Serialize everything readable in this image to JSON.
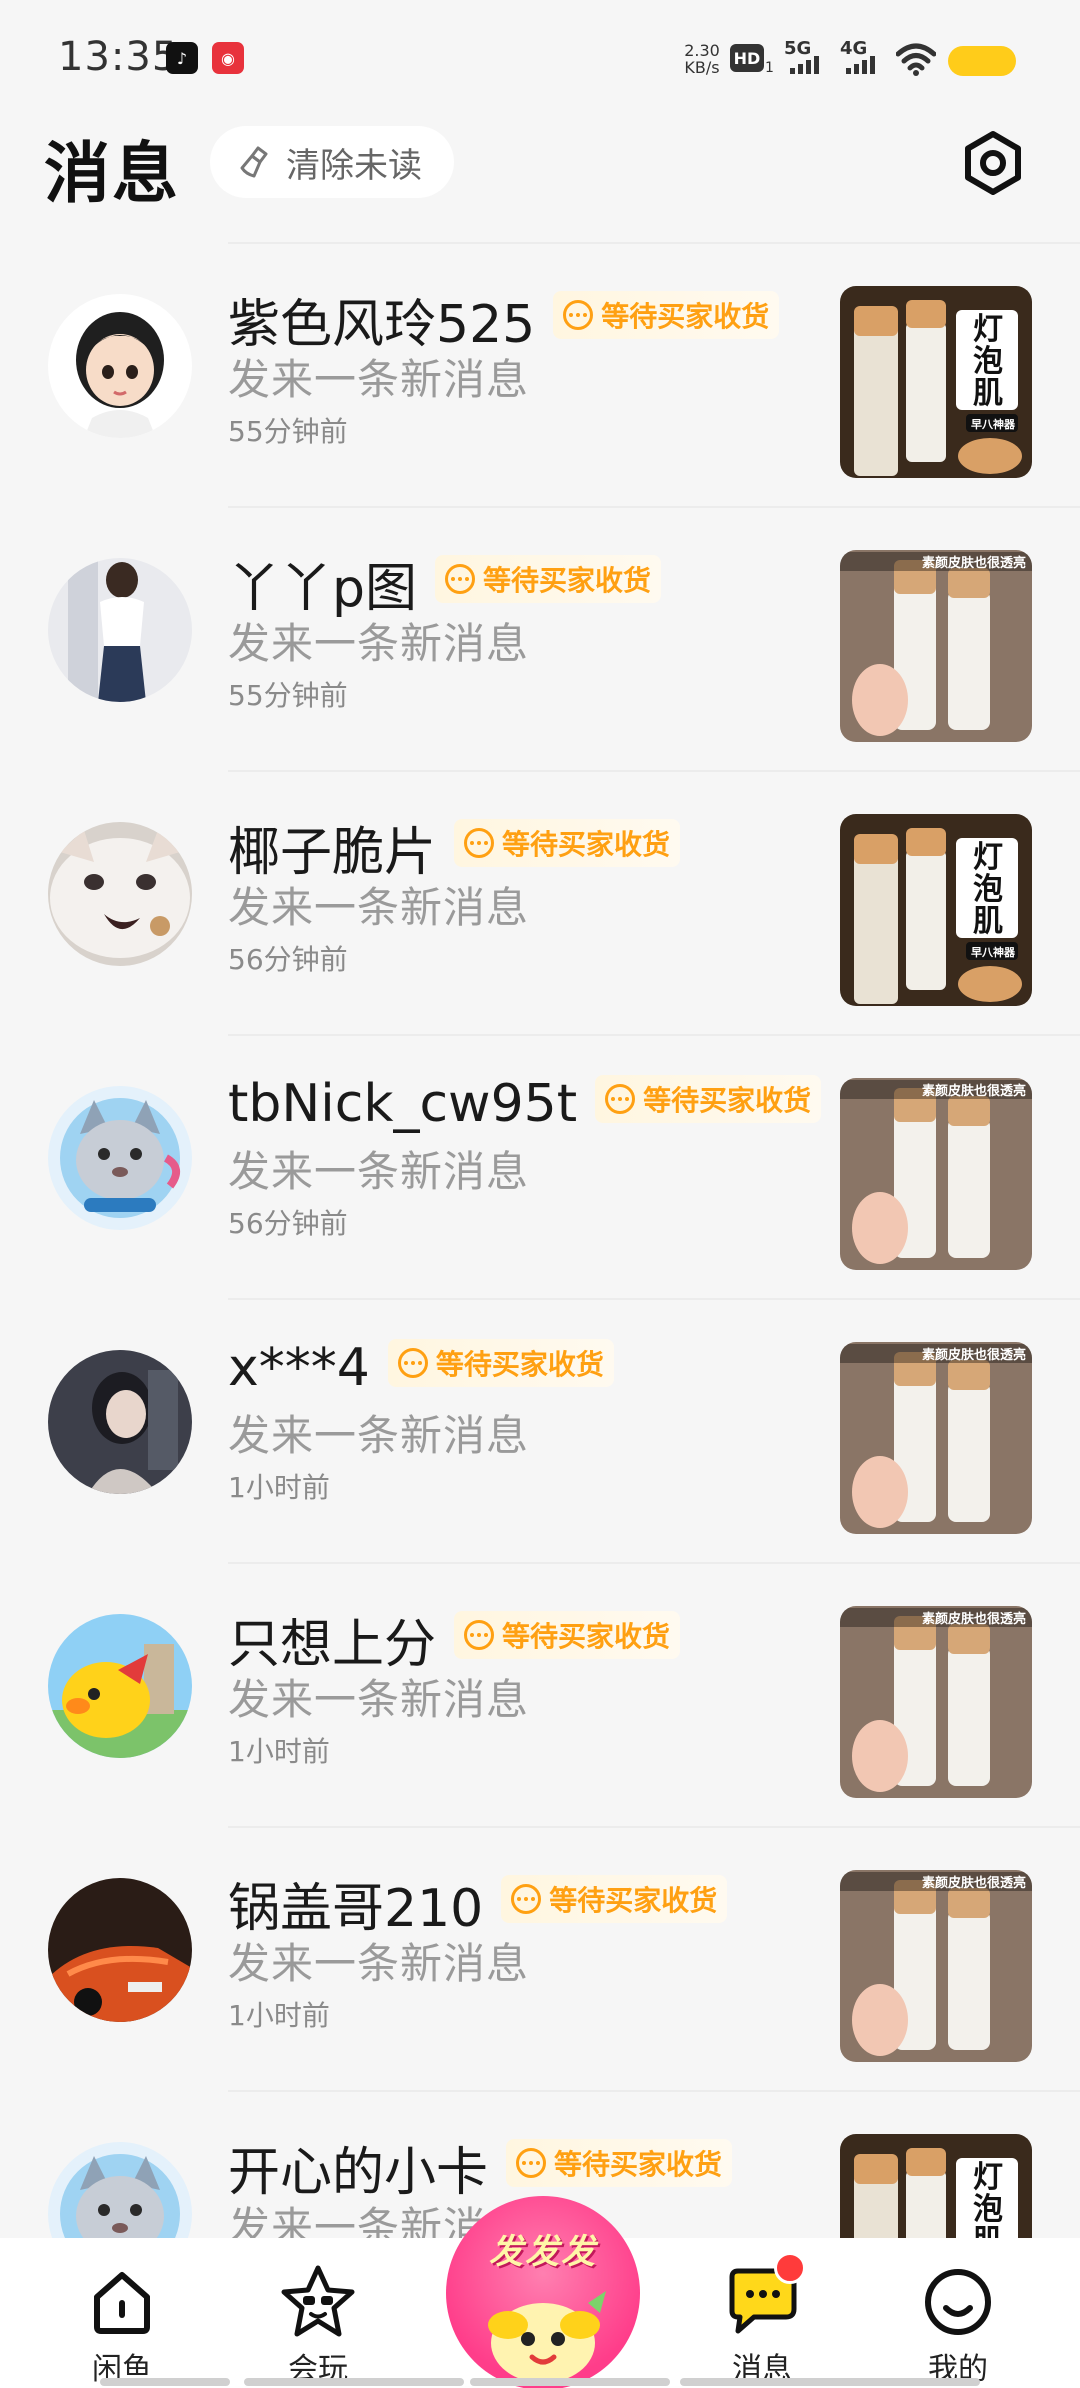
{
  "status_bar": {
    "time": "13:35",
    "net_speed_value": "2.30",
    "net_speed_unit": "KB/s",
    "hd_label": "HD",
    "hd_sub": "1",
    "sig1_label": "5G",
    "sig2_label": "4G",
    "notif_icons": [
      "tiktok-icon",
      "shopping-app-icon"
    ],
    "battery_color": "#ffcc1a"
  },
  "header": {
    "title": "消息",
    "clear_unread_label": "清除未读",
    "settings_icon": "hexagon-gear-icon"
  },
  "messages": [
    {
      "name": "紫色风玲525",
      "tag": "等待买家收货",
      "preview": "发来一条新消息",
      "time": "55分钟前",
      "thumb_caption": "灯泡肌",
      "thumb_sub": "早八神器"
    },
    {
      "name": "丫丫p图",
      "tag": "等待买家收货",
      "preview": "发来一条新消息",
      "time": "55分钟前",
      "thumb_caption": "素颜皮肤也很透亮",
      "thumb_sub": ""
    },
    {
      "name": "椰子脆片",
      "tag": "等待买家收货",
      "preview": "发来一条新消息",
      "time": "56分钟前",
      "thumb_caption": "灯泡肌",
      "thumb_sub": "早八神器"
    },
    {
      "name": "tbNick_cw95t",
      "tag": "等待买家收货",
      "preview": "发来一条新消息",
      "time": "56分钟前",
      "thumb_caption": "素颜皮肤也很透亮",
      "thumb_sub": ""
    },
    {
      "name": "x***4",
      "tag": "等待买家收货",
      "preview": "发来一条新消息",
      "time": "1小时前",
      "thumb_caption": "素颜皮肤也很透亮",
      "thumb_sub": ""
    },
    {
      "name": "只想上分",
      "tag": "等待买家收货",
      "preview": "发来一条新消息",
      "time": "1小时前",
      "thumb_caption": "素颜皮肤也很透亮",
      "thumb_sub": ""
    },
    {
      "name": "锅盖哥210",
      "tag": "等待买家收货",
      "preview": "发来一条新消息",
      "time": "1小时前",
      "thumb_caption": "素颜皮肤也很透亮",
      "thumb_sub": ""
    },
    {
      "name": "开心的小卡",
      "tag": "等待买家收货",
      "preview": "发来一条新消息",
      "time": "",
      "thumb_caption": "灯泡肌",
      "thumb_sub": ""
    }
  ],
  "bottom_nav": {
    "home_label": "闲鱼",
    "play_label": "会玩",
    "publish_label": "发发发",
    "messages_label": "消息",
    "mine_label": "我的",
    "badge_color": "#ff3b3b",
    "accent_color": "#ffa012"
  }
}
